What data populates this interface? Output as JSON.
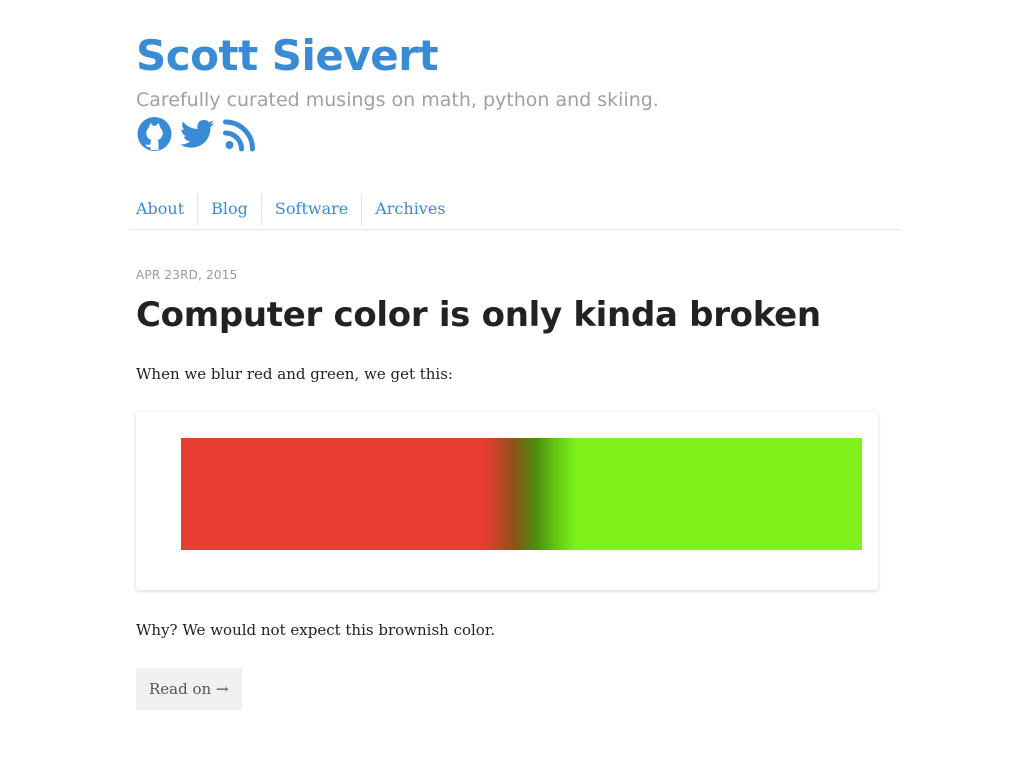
{
  "site": {
    "title": "Scott Sievert",
    "tagline": "Carefully curated musings on math, python and skiing.",
    "social_icons": [
      "github-icon",
      "twitter-icon",
      "rss-icon"
    ],
    "accent_color": "#3a8bd6"
  },
  "nav": {
    "items": [
      {
        "label": "About"
      },
      {
        "label": "Blog"
      },
      {
        "label": "Software"
      },
      {
        "label": "Archives"
      }
    ]
  },
  "post": {
    "date": "APR 23RD, 2015",
    "title": "Computer color is only kinda broken",
    "intro": "When we blur red and green, we get this:",
    "figure": {
      "description_colors": {
        "left": "#e63e30",
        "middle": "#8a5519",
        "right": "#7ff11a"
      }
    },
    "followup": "Why? We would not expect this brownish color.",
    "read_on_label": "Read on →"
  }
}
